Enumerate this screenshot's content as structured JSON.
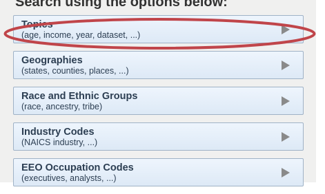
{
  "header": {
    "text": "Search using the options below:"
  },
  "items": [
    {
      "title": "Topics",
      "subtitle": "(age, income, year, dataset, ...)"
    },
    {
      "title": "Geographies",
      "subtitle": "(states, counties, places, ...)"
    },
    {
      "title": "Race and Ethnic Groups",
      "subtitle": "(race, ancestry, tribe)"
    },
    {
      "title": "Industry Codes",
      "subtitle": "(NAICS industry, ...)"
    },
    {
      "title": "EEO Occupation Codes",
      "subtitle": "(executives, analysts, ...)"
    }
  ],
  "colors": {
    "highlight_ring": "#c0454a",
    "button_border": "#9fb2c6",
    "text": "#2c3e52",
    "arrow": "#8a8a8a"
  },
  "icons": {
    "arrow": "triangle-right-icon"
  }
}
